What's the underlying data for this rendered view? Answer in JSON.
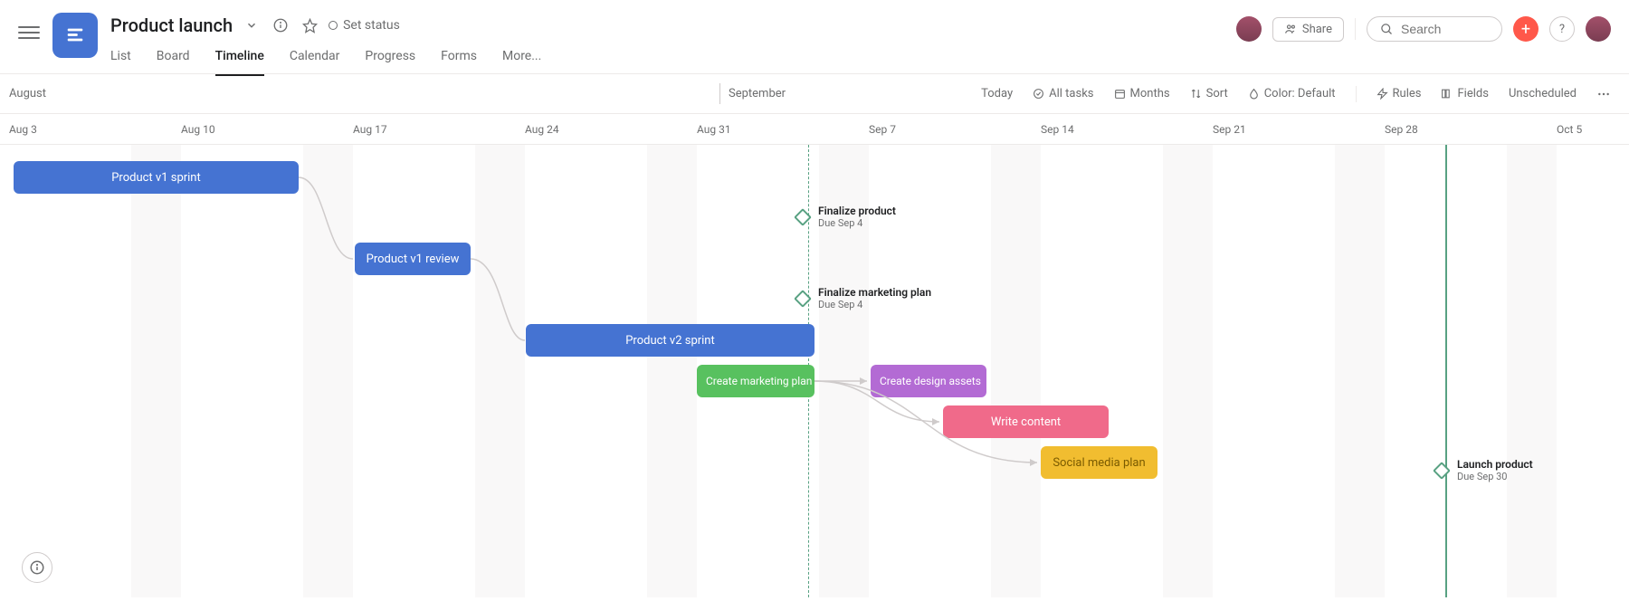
{
  "header": {
    "title": "Product launch",
    "status": "Set status",
    "tabs": [
      "List",
      "Board",
      "Timeline",
      "Calendar",
      "Progress",
      "Forms",
      "More..."
    ],
    "active_tab": "Timeline",
    "share": "Share",
    "search_placeholder": "Search"
  },
  "toolbar": {
    "months": [
      "August",
      "September"
    ],
    "today": "Today",
    "all_tasks": "All tasks",
    "zoom": "Months",
    "sort": "Sort",
    "color": "Color: Default",
    "rules": "Rules",
    "fields": "Fields",
    "unscheduled": "Unscheduled"
  },
  "dates": [
    "Aug 3",
    "Aug 10",
    "Aug 17",
    "Aug 24",
    "Aug 31",
    "Sep 7",
    "Sep 14",
    "Sep 21",
    "Sep 28",
    "Oct 5"
  ],
  "tasks": [
    {
      "id": "v1sprint",
      "label": "Product v1 sprint",
      "color": "#4573d2"
    },
    {
      "id": "v1review",
      "label": "Product v1 review",
      "color": "#4573d2"
    },
    {
      "id": "v2sprint",
      "label": "Product v2 sprint",
      "color": "#4573d2"
    },
    {
      "id": "mktplan",
      "label": "Create marketing plan",
      "color": "#58c15f"
    },
    {
      "id": "design",
      "label": "Create design assets",
      "color": "#b36bd4"
    },
    {
      "id": "write",
      "label": "Write content",
      "color": "#f06a8a"
    },
    {
      "id": "social",
      "label": "Social media plan",
      "color": "#f1bd30"
    }
  ],
  "milestones": [
    {
      "id": "finalprod",
      "title": "Finalize product",
      "due": "Due Sep 4",
      "color": "#58a182"
    },
    {
      "id": "finalmkt",
      "title": "Finalize marketing plan",
      "due": "Due Sep 4",
      "color": "#58a182"
    },
    {
      "id": "launch",
      "title": "Launch product",
      "due": "Due Sep 30",
      "color": "#58a182"
    }
  ]
}
